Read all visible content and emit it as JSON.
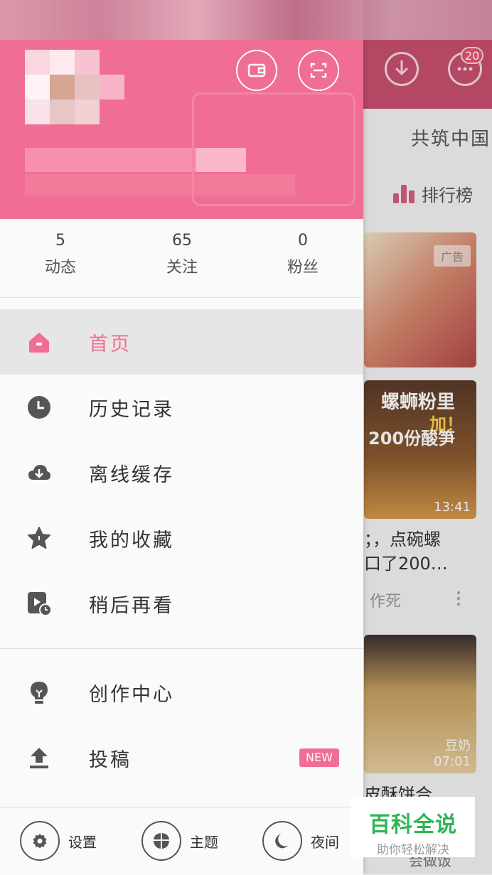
{
  "background": {
    "badge_count": "20",
    "banner_text": "共筑中国",
    "rank_label": "排行榜",
    "ad_label": "广告",
    "card2_overlay_line1": "螺蛳粉里",
    "card2_overlay_line2": "加！",
    "card2_overlay_line3": "200份酸笋",
    "card2_duration": "13:41",
    "card2_title": "；，点碗螺\n口了200…",
    "card2_author": "作死",
    "card3_tag": "豆奶",
    "card3_duration": "07:01",
    "card3_title": "皮酥饼合",
    "card3_author": "会做饭"
  },
  "stats": [
    {
      "count": "5",
      "label": "动态"
    },
    {
      "count": "65",
      "label": "关注"
    },
    {
      "count": "0",
      "label": "粉丝"
    }
  ],
  "menu": {
    "home": "首页",
    "history": "历史记录",
    "offline": "离线缓存",
    "favorites": "我的收藏",
    "watch_later": "稍后再看",
    "creator_center": "创作中心",
    "upload": "投稿",
    "new_badge": "NEW"
  },
  "bottom": {
    "settings": "设置",
    "theme": "主题",
    "night": "夜间"
  },
  "watermark": {
    "title": "百科全说",
    "subtitle": "助你轻松解决"
  },
  "colors": {
    "accent": "#f06e93",
    "watermark_green": "#2fb553"
  }
}
